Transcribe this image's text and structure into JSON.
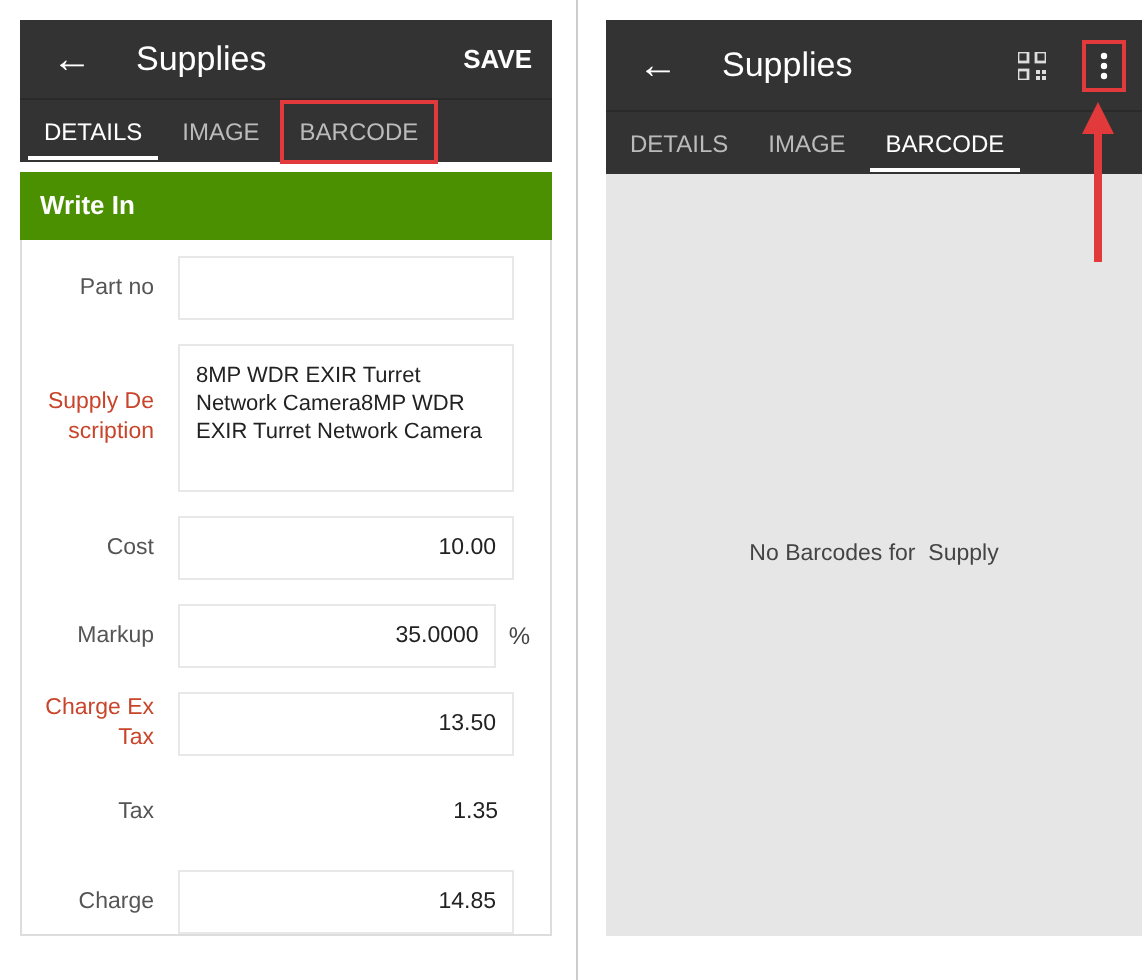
{
  "screens": [
    {
      "title": "Supplies",
      "back": "←",
      "action": {
        "kind": "text",
        "label": "SAVE",
        "highlighted": false
      },
      "tabs": [
        {
          "label": "DETAILS",
          "selected": true,
          "highlighted": false
        },
        {
          "label": "IMAGE",
          "selected": false,
          "highlighted": false
        },
        {
          "label": "BARCODE",
          "selected": false,
          "highlighted": true
        }
      ],
      "section": "Write In",
      "fields": [
        {
          "kind": "input",
          "label": "Part no",
          "required": false
        },
        {
          "kind": "textarea",
          "label": "Supply De scription",
          "required": true,
          "value": "8MP WDR EXIR Turret Network Camera8MP WDR EXIR Turret Network Camera"
        },
        {
          "kind": "input",
          "label": "Cost",
          "required": false,
          "value": "10.00"
        },
        {
          "kind": "input",
          "label": "Markup",
          "required": false,
          "value": "35.0000",
          "suffix": "%"
        },
        {
          "kind": "input",
          "label": "Charge Ex Tax",
          "required": true,
          "value": "13.50"
        },
        {
          "kind": "text",
          "label": "Tax",
          "required": false,
          "value": "1.35"
        },
        {
          "kind": "input",
          "label": "Charge",
          "required": false,
          "value": "14.85"
        }
      ]
    },
    {
      "title": "Supplies",
      "back": "←",
      "action": {
        "kind": "icons",
        "highlighted": true
      },
      "tabs": [
        {
          "label": "DETAILS",
          "selected": false,
          "highlighted": false
        },
        {
          "label": "IMAGE",
          "selected": false,
          "highlighted": false
        },
        {
          "label": "BARCODE",
          "selected": true,
          "highlighted": false
        }
      ],
      "empty_message": "No Barcodes for  Supply"
    }
  ]
}
